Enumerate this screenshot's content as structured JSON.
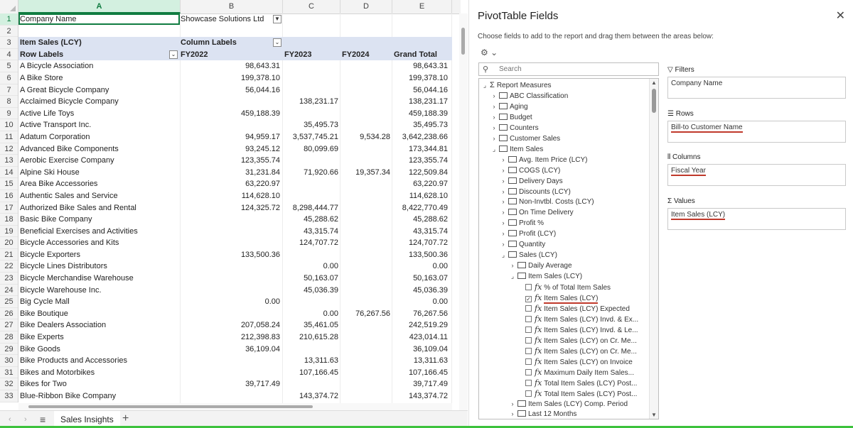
{
  "sheet": {
    "columns": [
      "A",
      "B",
      "C",
      "D",
      "E"
    ],
    "row_numbers": [
      "1",
      "2",
      "3",
      "4",
      "5",
      "6",
      "7",
      "8",
      "9",
      "10",
      "11",
      "12",
      "13",
      "14",
      "15",
      "16",
      "17",
      "18",
      "19",
      "20",
      "21",
      "22",
      "23",
      "24",
      "25",
      "26",
      "27",
      "28",
      "29",
      "30",
      "31",
      "32",
      "33"
    ],
    "filter_row": {
      "label": "Company Name",
      "value": "Showcase Solutions Ltd"
    },
    "measure_label": "Item Sales (LCY)",
    "column_labels": "Column Labels",
    "header": {
      "row_labels": "Row Labels",
      "fy2022": "FY2022",
      "fy2023": "FY2023",
      "fy2024": "FY2024",
      "grand_total": "Grand Total"
    },
    "rows": [
      {
        "name": "A Bicycle Association",
        "fy2022": "98,643.31",
        "fy2023": "",
        "fy2024": "",
        "total": "98,643.31"
      },
      {
        "name": "A Bike Store",
        "fy2022": "199,378.10",
        "fy2023": "",
        "fy2024": "",
        "total": "199,378.10"
      },
      {
        "name": "A Great Bicycle Company",
        "fy2022": "56,044.16",
        "fy2023": "",
        "fy2024": "",
        "total": "56,044.16"
      },
      {
        "name": "Acclaimed Bicycle Company",
        "fy2022": "",
        "fy2023": "138,231.17",
        "fy2024": "",
        "total": "138,231.17"
      },
      {
        "name": "Active Life Toys",
        "fy2022": "459,188.39",
        "fy2023": "",
        "fy2024": "",
        "total": "459,188.39"
      },
      {
        "name": "Active Transport Inc.",
        "fy2022": "",
        "fy2023": "35,495.73",
        "fy2024": "",
        "total": "35,495.73"
      },
      {
        "name": "Adatum Corporation",
        "fy2022": "94,959.17",
        "fy2023": "3,537,745.21",
        "fy2024": "9,534.28",
        "total": "3,642,238.66"
      },
      {
        "name": "Advanced Bike Components",
        "fy2022": "93,245.12",
        "fy2023": "80,099.69",
        "fy2024": "",
        "total": "173,344.81"
      },
      {
        "name": "Aerobic Exercise Company",
        "fy2022": "123,355.74",
        "fy2023": "",
        "fy2024": "",
        "total": "123,355.74"
      },
      {
        "name": "Alpine Ski House",
        "fy2022": "31,231.84",
        "fy2023": "71,920.66",
        "fy2024": "19,357.34",
        "total": "122,509.84"
      },
      {
        "name": "Area Bike Accessories",
        "fy2022": "63,220.97",
        "fy2023": "",
        "fy2024": "",
        "total": "63,220.97"
      },
      {
        "name": "Authentic Sales and Service",
        "fy2022": "114,628.10",
        "fy2023": "",
        "fy2024": "",
        "total": "114,628.10"
      },
      {
        "name": "Authorized Bike Sales and Rental",
        "fy2022": "124,325.72",
        "fy2023": "8,298,444.77",
        "fy2024": "",
        "total": "8,422,770.49"
      },
      {
        "name": "Basic Bike Company",
        "fy2022": "",
        "fy2023": "45,288.62",
        "fy2024": "",
        "total": "45,288.62"
      },
      {
        "name": "Beneficial Exercises and Activities",
        "fy2022": "",
        "fy2023": "43,315.74",
        "fy2024": "",
        "total": "43,315.74"
      },
      {
        "name": "Bicycle Accessories and Kits",
        "fy2022": "",
        "fy2023": "124,707.72",
        "fy2024": "",
        "total": "124,707.72"
      },
      {
        "name": "Bicycle Exporters",
        "fy2022": "133,500.36",
        "fy2023": "",
        "fy2024": "",
        "total": "133,500.36"
      },
      {
        "name": "Bicycle Lines Distributors",
        "fy2022": "",
        "fy2023": "0.00",
        "fy2024": "",
        "total": "0.00"
      },
      {
        "name": "Bicycle Merchandise Warehouse",
        "fy2022": "",
        "fy2023": "50,163.07",
        "fy2024": "",
        "total": "50,163.07"
      },
      {
        "name": "Bicycle Warehouse Inc.",
        "fy2022": "",
        "fy2023": "45,036.39",
        "fy2024": "",
        "total": "45,036.39"
      },
      {
        "name": "Big Cycle Mall",
        "fy2022": "0.00",
        "fy2023": "",
        "fy2024": "",
        "total": "0.00"
      },
      {
        "name": "Bike Boutique",
        "fy2022": "",
        "fy2023": "0.00",
        "fy2024": "76,267.56",
        "total": "76,267.56"
      },
      {
        "name": "Bike Dealers Association",
        "fy2022": "207,058.24",
        "fy2023": "35,461.05",
        "fy2024": "",
        "total": "242,519.29"
      },
      {
        "name": "Bike Experts",
        "fy2022": "212,398.83",
        "fy2023": "210,615.28",
        "fy2024": "",
        "total": "423,014.11"
      },
      {
        "name": "Bike Goods",
        "fy2022": "36,109.04",
        "fy2023": "",
        "fy2024": "",
        "total": "36,109.04"
      },
      {
        "name": "Bike Products and Accessories",
        "fy2022": "",
        "fy2023": "13,311.63",
        "fy2024": "",
        "total": "13,311.63"
      },
      {
        "name": "Bikes and Motorbikes",
        "fy2022": "",
        "fy2023": "107,166.45",
        "fy2024": "",
        "total": "107,166.45"
      },
      {
        "name": "Bikes for Two",
        "fy2022": "39,717.49",
        "fy2023": "",
        "fy2024": "",
        "total": "39,717.49"
      },
      {
        "name": "Blue-Ribbon Bike Company",
        "fy2022": "",
        "fy2023": "143,374.72",
        "fy2024": "",
        "total": "143,374.72"
      }
    ],
    "sheet_tab": "Sales Insights",
    "add_sheet": "+"
  },
  "pane": {
    "title": "PivotTable Fields",
    "close": "✕",
    "description": "Choose fields to add to the report and drag them between the areas below:",
    "gear": "⚙ ⌄",
    "search_placeholder": "Search",
    "tree": [
      {
        "indent": 0,
        "toggle": "⌟",
        "type": "sigma",
        "label": "Report Measures"
      },
      {
        "indent": 1,
        "toggle": "›",
        "type": "folder",
        "label": "ABC Classification"
      },
      {
        "indent": 1,
        "toggle": "›",
        "type": "folder",
        "label": "Aging"
      },
      {
        "indent": 1,
        "toggle": "›",
        "type": "folder",
        "label": "Budget"
      },
      {
        "indent": 1,
        "toggle": "›",
        "type": "folder",
        "label": "Counters"
      },
      {
        "indent": 1,
        "toggle": "›",
        "type": "folder",
        "label": "Customer Sales"
      },
      {
        "indent": 1,
        "toggle": "⌟",
        "type": "folder",
        "label": "Item Sales"
      },
      {
        "indent": 2,
        "toggle": "›",
        "type": "folder",
        "label": "Avg. Item Price (LCY)"
      },
      {
        "indent": 2,
        "toggle": "›",
        "type": "folder",
        "label": "COGS (LCY)"
      },
      {
        "indent": 2,
        "toggle": "›",
        "type": "folder",
        "label": "Delivery Days"
      },
      {
        "indent": 2,
        "toggle": "›",
        "type": "folder",
        "label": "Discounts (LCY)"
      },
      {
        "indent": 2,
        "toggle": "›",
        "type": "folder",
        "label": "Non-Invtbl. Costs (LCY)"
      },
      {
        "indent": 2,
        "toggle": "›",
        "type": "folder",
        "label": "On Time Delivery"
      },
      {
        "indent": 2,
        "toggle": "›",
        "type": "folder",
        "label": "Profit %"
      },
      {
        "indent": 2,
        "toggle": "›",
        "type": "folder",
        "label": "Profit (LCY)"
      },
      {
        "indent": 2,
        "toggle": "›",
        "type": "folder",
        "label": "Quantity"
      },
      {
        "indent": 2,
        "toggle": "⌟",
        "type": "folder",
        "label": "Sales (LCY)"
      },
      {
        "indent": 3,
        "toggle": "›",
        "type": "folder",
        "label": "Daily Average"
      },
      {
        "indent": 3,
        "toggle": "⌟",
        "type": "folder",
        "label": "Item Sales (LCY)"
      },
      {
        "indent": 4,
        "toggle": "",
        "type": "fx",
        "label": "% of Total Item Sales",
        "checked": false
      },
      {
        "indent": 4,
        "toggle": "",
        "type": "fx",
        "label": "Item Sales (LCY)",
        "checked": true,
        "underline": true
      },
      {
        "indent": 4,
        "toggle": "",
        "type": "fx",
        "label": "Item Sales (LCY) Expected",
        "checked": false
      },
      {
        "indent": 4,
        "toggle": "",
        "type": "fx",
        "label": "Item Sales (LCY) Invd. & Ex...",
        "checked": false
      },
      {
        "indent": 4,
        "toggle": "",
        "type": "fx",
        "label": "Item Sales (LCY) Invd. & Le...",
        "checked": false
      },
      {
        "indent": 4,
        "toggle": "",
        "type": "fx",
        "label": "Item Sales (LCY) on Cr. Me...",
        "checked": false
      },
      {
        "indent": 4,
        "toggle": "",
        "type": "fx",
        "label": "Item Sales (LCY) on Cr. Me...",
        "checked": false
      },
      {
        "indent": 4,
        "toggle": "",
        "type": "fx",
        "label": "Item Sales (LCY) on Invoice",
        "checked": false
      },
      {
        "indent": 4,
        "toggle": "",
        "type": "fx",
        "label": "Maximum Daily Item Sales...",
        "checked": false
      },
      {
        "indent": 4,
        "toggle": "",
        "type": "fx",
        "label": "Total Item Sales (LCY) Post...",
        "checked": false
      },
      {
        "indent": 4,
        "toggle": "",
        "type": "fx",
        "label": "Total Item Sales (LCY) Post...",
        "checked": false
      },
      {
        "indent": 3,
        "toggle": "›",
        "type": "folder",
        "label": "Item Sales (LCY) Comp. Period"
      },
      {
        "indent": 3,
        "toggle": "›",
        "type": "folder",
        "label": "Last 12 Months"
      }
    ],
    "areas": {
      "filters": {
        "icon": "▽",
        "label": "Filters",
        "value": "Company Name"
      },
      "rows": {
        "icon": "☰",
        "label": "Rows",
        "value": "Bill-to Customer Name"
      },
      "columns": {
        "icon": "⫴",
        "label": "Columns",
        "value": "Fiscal Year"
      },
      "values": {
        "icon": "Σ",
        "label": "Values",
        "value": "Item Sales (LCY)"
      }
    }
  },
  "colors": {
    "accent": "#107c41",
    "header_band": "#dce3f2",
    "underline": "#c0392b"
  }
}
